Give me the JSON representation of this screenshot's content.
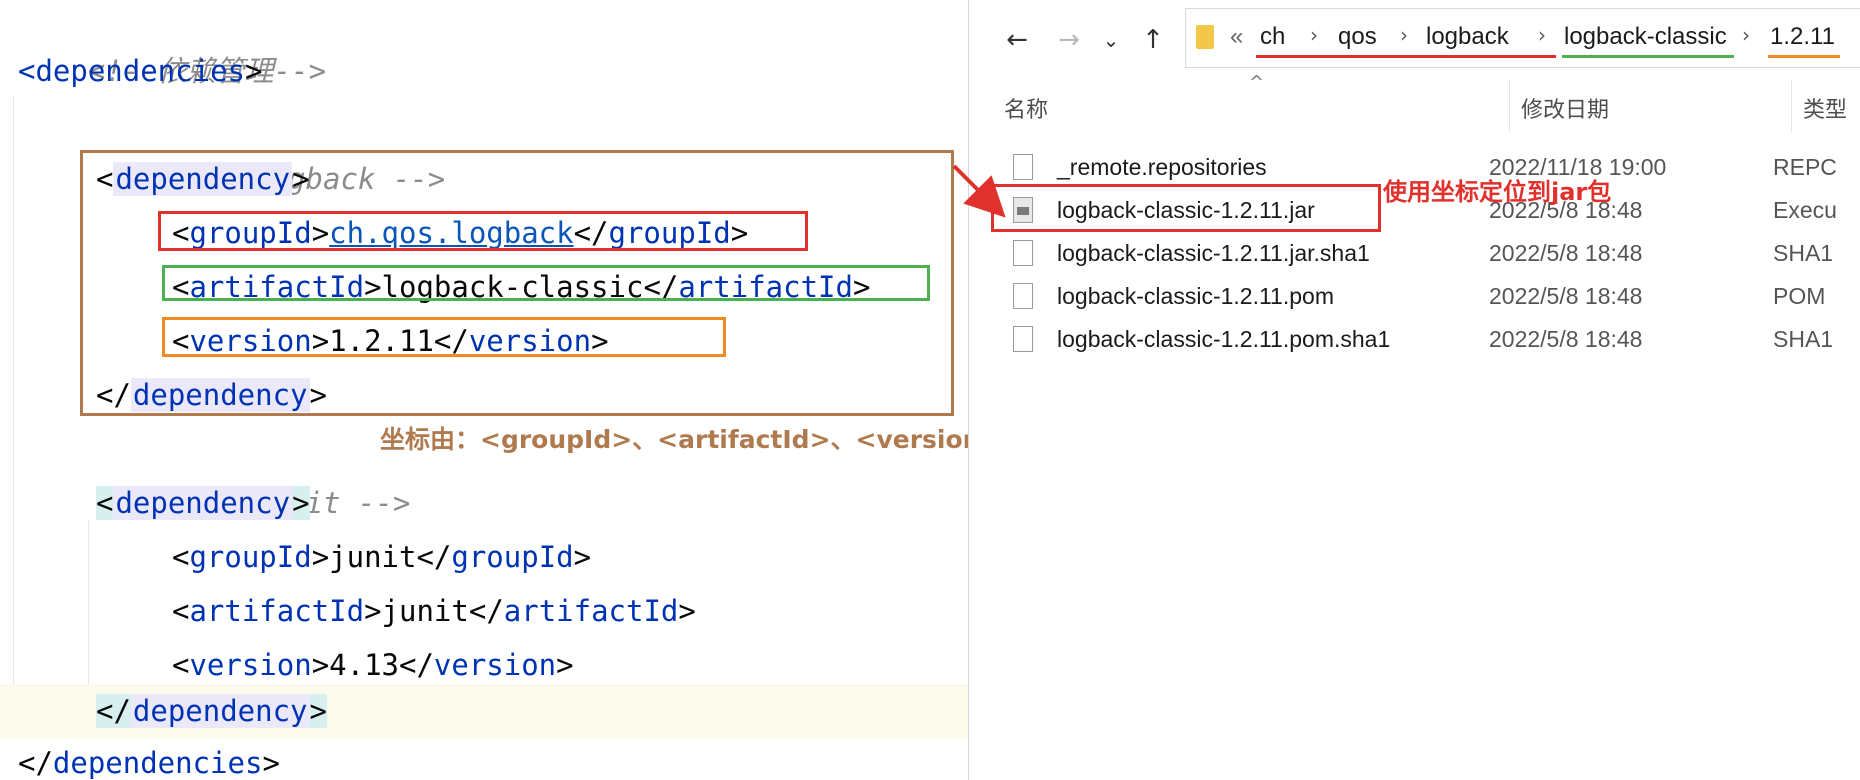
{
  "editor": {
    "comment_dep_mgmt": "<!--依赖管理-->",
    "deps_open": "dependencies",
    "comment_logback": "<!-- logback -->",
    "dep_tag": "dependency",
    "group_tag": "groupId",
    "artifact_tag": "artifactId",
    "version_tag": "version",
    "logback_group": "ch.qos.logback",
    "logback_artifact": "logback-classic",
    "logback_version": "1.2.11",
    "comment_junit": "<!-- junit -->",
    "junit_group": "junit",
    "junit_artifact": "junit",
    "junit_version": "4.13"
  },
  "annotations": {
    "coord_note": "坐标由：<groupId>、<artifactId>、<version>三个标签组成",
    "locate_note": "使用坐标定位到jar包",
    "colors": {
      "brown": "#b07a4f",
      "red": "#e0312d",
      "green": "#4caf50",
      "orange": "#f08a24"
    }
  },
  "explorer": {
    "back_icon": "←",
    "forward_icon": "→",
    "recent_icon": "⌄",
    "up_icon": "↑",
    "overflow": "«",
    "breadcrumb": [
      "ch",
      "qos",
      "logback",
      "logback-classic",
      "1.2.11"
    ],
    "sort_indicator": "^",
    "columns": {
      "name": "名称",
      "date": "修改日期",
      "type": "类型"
    },
    "files": [
      {
        "name": "_remote.repositories",
        "date": "2022/11/18 19:00",
        "type": "REPC"
      },
      {
        "name": "logback-classic-1.2.11.jar",
        "date": "2022/5/8 18:48",
        "type": "Execu"
      },
      {
        "name": "logback-classic-1.2.11.jar.sha1",
        "date": "2022/5/8 18:48",
        "type": "SHA1"
      },
      {
        "name": "logback-classic-1.2.11.pom",
        "date": "2022/5/8 18:48",
        "type": "POM"
      },
      {
        "name": "logback-classic-1.2.11.pom.sha1",
        "date": "2022/5/8 18:48",
        "type": "SHA1"
      }
    ]
  }
}
